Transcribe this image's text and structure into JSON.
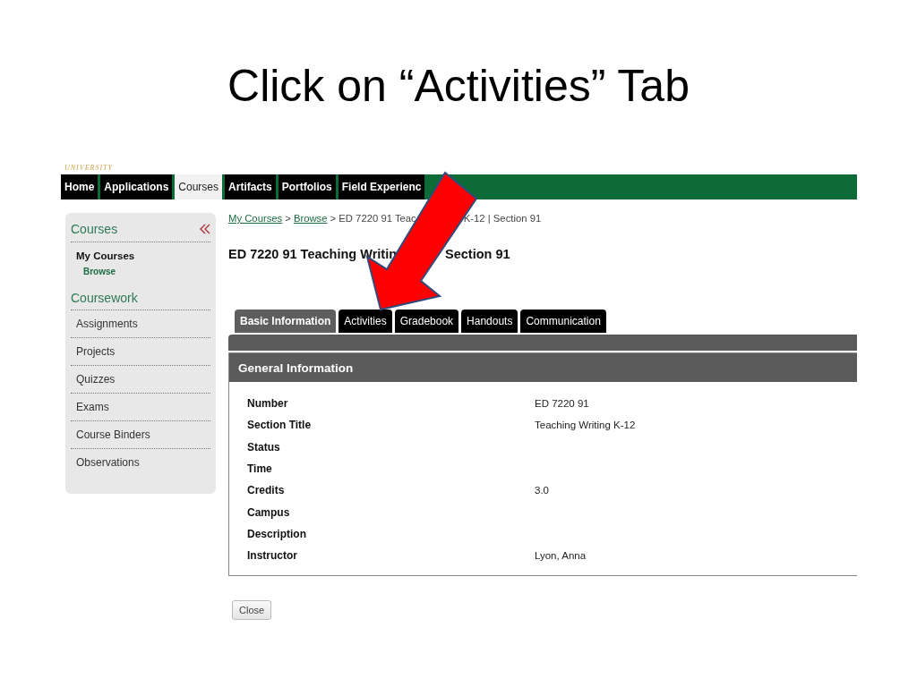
{
  "slide_title": "Click on “Activities” Tab",
  "header": {
    "university": "UNIVERSITY"
  },
  "nav": [
    {
      "label": "Home",
      "selected": false
    },
    {
      "label": "Applications",
      "selected": false
    },
    {
      "label": "Courses",
      "selected": true
    },
    {
      "label": "Artifacts",
      "selected": false
    },
    {
      "label": "Portfolios",
      "selected": false
    },
    {
      "label": "Field Experienc",
      "selected": false
    }
  ],
  "sidebar": {
    "title": "Courses",
    "links": [
      {
        "label": "My Courses",
        "selected": true,
        "children": [
          {
            "label": "Browse",
            "selected": false
          }
        ]
      }
    ],
    "section": "Coursework",
    "items": [
      "Assignments",
      "Projects",
      "Quizzes",
      "Exams",
      "Course Binders",
      "Observations"
    ]
  },
  "breadcrumb": [
    {
      "label": "My Courses",
      "kind": "link"
    },
    {
      "label": ">",
      "kind": "text"
    },
    {
      "label": "Browse",
      "kind": "link"
    },
    {
      "label": "> ED 7220 91 Teac",
      "kind": "text"
    },
    {
      "label": "K-12 | Section 91",
      "kind": "after_arrow"
    }
  ],
  "heading": [
    {
      "label": "ED 7220 91 Teaching Writin",
      "kind": "text"
    },
    {
      "label": "Section 91",
      "kind": "after_arrow"
    }
  ],
  "tabs": [
    {
      "label": "Basic Information",
      "selected": true
    },
    {
      "label": "Activities",
      "selected": false
    },
    {
      "label": "Gradebook",
      "selected": false
    },
    {
      "label": "Handouts",
      "selected": false
    },
    {
      "label": "Communication",
      "selected": false
    }
  ],
  "panel": {
    "title": "General Information",
    "rows": [
      {
        "label": "Number",
        "value": "ED 7220 91"
      },
      {
        "label": "Section Title",
        "value": "Teaching Writing K-12"
      },
      {
        "label": "Status"
      },
      {
        "label": "Time"
      },
      {
        "label": "Credits",
        "value": "3.0"
      },
      {
        "label": "Campus"
      },
      {
        "label": "Description"
      },
      {
        "label": "Instructor",
        "value": "Lyon, Anna"
      }
    ]
  },
  "close_button": "Close"
}
